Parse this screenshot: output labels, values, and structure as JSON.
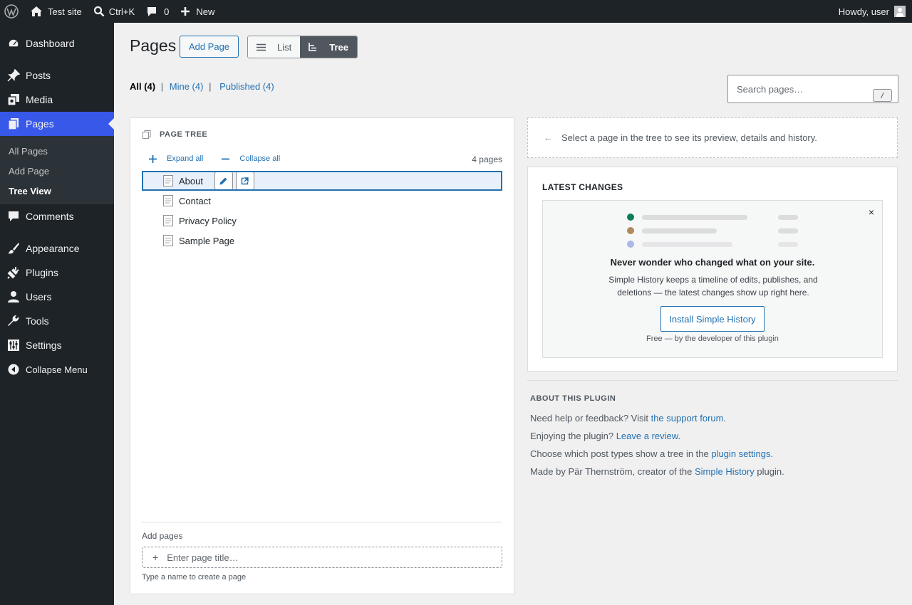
{
  "adminbar": {
    "site_name": "Test site",
    "search_shortcut": "Ctrl+K",
    "comments_count": "0",
    "new_label": "New",
    "greeting": "Howdy, user"
  },
  "sidebar": {
    "items": [
      {
        "label": "Dashboard",
        "icon": "dashboard-icon"
      },
      {
        "label": "Posts",
        "icon": "pin-icon"
      },
      {
        "label": "Media",
        "icon": "media-icon"
      },
      {
        "label": "Pages",
        "icon": "pages-icon"
      },
      {
        "label": "Comments",
        "icon": "comment-icon"
      },
      {
        "label": "Appearance",
        "icon": "brush-icon"
      },
      {
        "label": "Plugins",
        "icon": "plug-icon"
      },
      {
        "label": "Users",
        "icon": "user-icon"
      },
      {
        "label": "Tools",
        "icon": "wrench-icon"
      },
      {
        "label": "Settings",
        "icon": "sliders-icon"
      },
      {
        "label": "Collapse Menu",
        "icon": "collapse-icon"
      }
    ],
    "submenu": [
      "All Pages",
      "Add Page",
      "Tree View"
    ]
  },
  "header": {
    "title": "Pages",
    "add_page": "Add Page",
    "view_list": "List",
    "view_tree": "Tree"
  },
  "filters": {
    "all": "All (4)",
    "mine": "Mine (4)",
    "published": "Published (4)",
    "sep": "|"
  },
  "search": {
    "placeholder": "Search pages…",
    "shortcut": "/"
  },
  "tree": {
    "heading": "PAGE TREE",
    "expand_all": "Expand all",
    "collapse_all": "Collapse all",
    "count": "4 pages",
    "pages": [
      "About",
      "Contact",
      "Privacy Policy",
      "Sample Page"
    ],
    "selected_index": 0,
    "add_label": "Add pages",
    "add_placeholder": "Enter page title…",
    "add_hint": "Type a name to create a page"
  },
  "preview": {
    "arrow": "←",
    "text": "Select a page in the tree to see its preview, details and history."
  },
  "latest": {
    "heading": "LATEST CHANGES",
    "close": "×",
    "promo_title": "Never wonder who changed what on your site.",
    "promo_desc": "Simple History keeps a timeline of edits, publishes, and deletions — the latest changes show up right here.",
    "install_label": "Install Simple History",
    "free_note": "Free — by the developer of this plugin",
    "dot_colors": [
      "#0e7c5a",
      "#b08a5c",
      "#a9b8e6"
    ]
  },
  "about": {
    "heading": "ABOUT THIS PLUGIN",
    "line1_text": "Need help or feedback? Visit ",
    "line1_link": "the support forum",
    "line1_end": ".",
    "line2_text": "Enjoying the plugin? ",
    "line2_link": "Leave a review",
    "line2_end": ".",
    "line3_text": "Choose which post types show a tree in the ",
    "line3_link": "plugin settings",
    "line3_end": ".",
    "line4_text": "Made by Pär Thernström, creator of the ",
    "line4_link": "Simple History",
    "line4_end": " plugin."
  },
  "colors": {
    "accent": "#3858e9",
    "link": "#2271b1",
    "adminbar": "#1d2327"
  }
}
